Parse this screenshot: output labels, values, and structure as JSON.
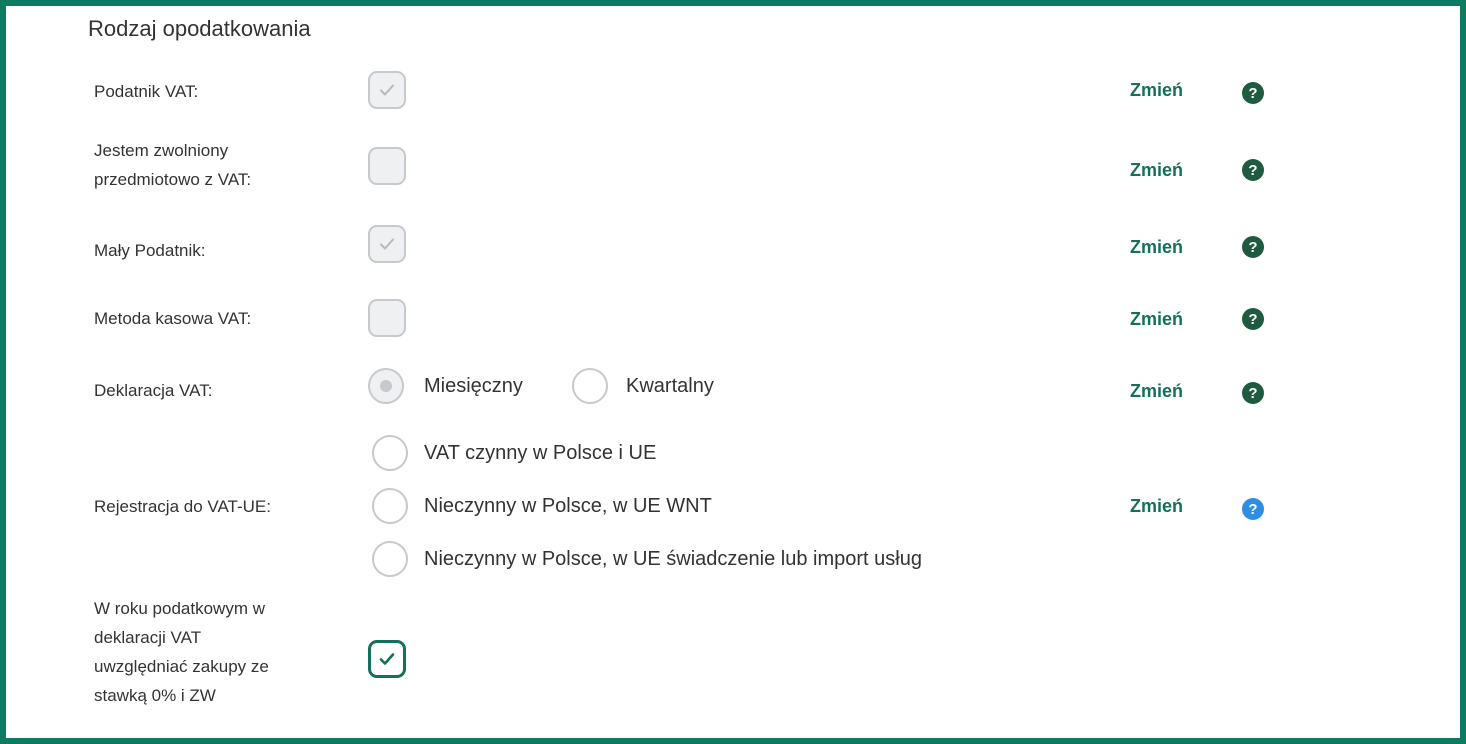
{
  "section_title": "Rodzaj opodatkowania",
  "change_label": "Zmień",
  "help_glyph": "?",
  "rows": {
    "vat_payer": {
      "label": "Podatnik VAT:",
      "checked": true
    },
    "exempt": {
      "label_line1": "Jestem zwolniony",
      "label_line2": "przedmiotowo z VAT:",
      "checked": false
    },
    "small_payer": {
      "label": "Mały Podatnik:",
      "checked": true
    },
    "cash_method": {
      "label": "Metoda kasowa VAT:",
      "checked": false
    },
    "declaration": {
      "label": "Deklaracja VAT:",
      "options": [
        "Miesięczny",
        "Kwartalny"
      ],
      "selected": "Miesięczny"
    },
    "eu_registration": {
      "label": "Rejestracja do VAT-UE:",
      "options": [
        "VAT czynny w Polsce i UE",
        "Nieczynny w Polsce, w UE WNT",
        "Nieczynny w Polsce, w UE świadczenie lub import usług"
      ],
      "selected": null
    },
    "zero_rate": {
      "label_lines": [
        "W roku podatkowym w",
        "deklaracji VAT",
        "uwzględniać zakupy ze",
        "stawką 0% i ZW"
      ],
      "checked": true
    }
  },
  "colors": {
    "border": "#0e7a5f",
    "accent": "#14705a",
    "help_dark": "#1f5c3f",
    "help_blue": "#2d8ee4"
  }
}
